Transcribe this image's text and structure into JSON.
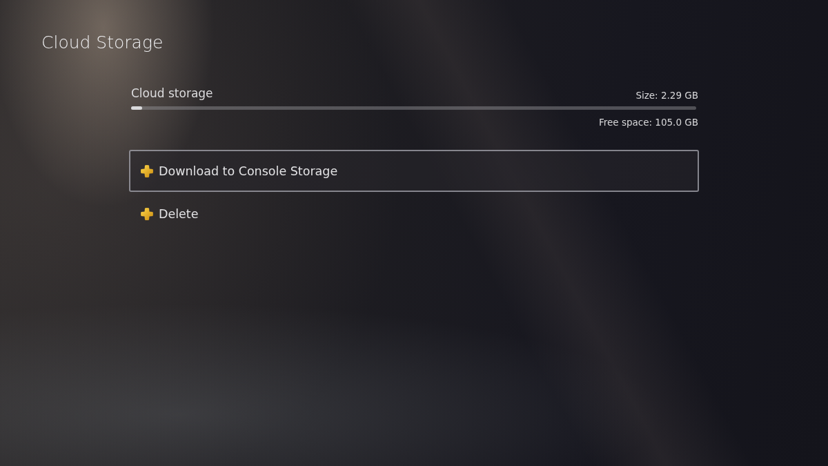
{
  "page": {
    "title": "Cloud Storage"
  },
  "storage": {
    "label": "Cloud storage",
    "size": "Size: 2.29 GB",
    "level": 0.02,
    "free_space": "Free space: 105.0 GB"
  },
  "actions": [
    {
      "label": "Download to Console Storage",
      "selected": true
    },
    {
      "label": "Delete",
      "selected": false
    }
  ]
}
